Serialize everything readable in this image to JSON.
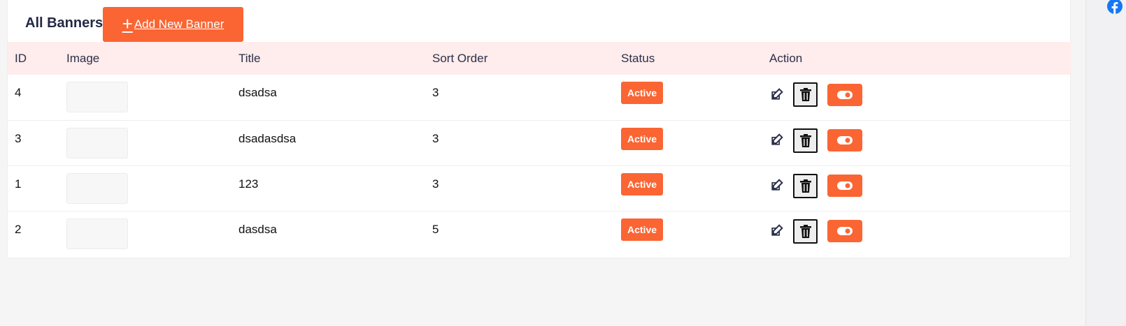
{
  "header": {
    "title": "All Banners",
    "add_button_label": "Add New Banner"
  },
  "table": {
    "columns": [
      "ID",
      "Image",
      "Title",
      "Sort Order",
      "Status",
      "Action"
    ],
    "rows": [
      {
        "id": "4",
        "title": "dsadsa",
        "sort_order": "3",
        "status": "Active"
      },
      {
        "id": "3",
        "title": "dsadasdsa",
        "sort_order": "3",
        "status": "Active"
      },
      {
        "id": "1",
        "title": "123",
        "sort_order": "3",
        "status": "Active"
      },
      {
        "id": "2",
        "title": "dasdsa",
        "sort_order": "5",
        "status": "Active"
      }
    ]
  },
  "icons": {
    "edit": "edit-icon",
    "delete": "trash-icon",
    "toggle": "toggle-on-icon",
    "social": "facebook-icon"
  },
  "colors": {
    "accent": "#fa6533",
    "header_row": "#ffecec",
    "facebook": "#1877f2"
  }
}
